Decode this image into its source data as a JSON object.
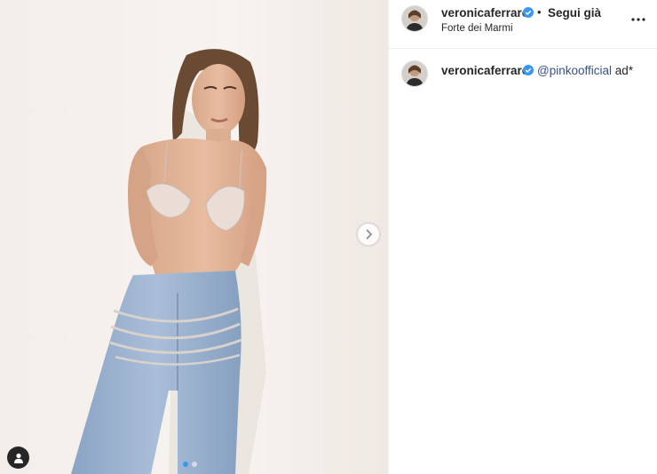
{
  "post": {
    "author": {
      "username": "veronicaferraro",
      "verified": true,
      "follow_status": "Segui già",
      "location": "Forte dei Marmi"
    },
    "separator": "•",
    "caption": {
      "username": "veronicaferraro",
      "mention": "@pinkoofficial",
      "text": " ad*"
    },
    "carousel": {
      "slide_count": 2,
      "active_index": 0
    }
  },
  "icons": {
    "verified": "verified-badge-icon",
    "more": "more-options-icon",
    "next": "chevron-right-icon",
    "tags": "user-tag-icon"
  },
  "colors": {
    "verified_blue": "#3897f0",
    "mention_blue": "#385185",
    "text": "#262626",
    "border": "#efefef"
  }
}
